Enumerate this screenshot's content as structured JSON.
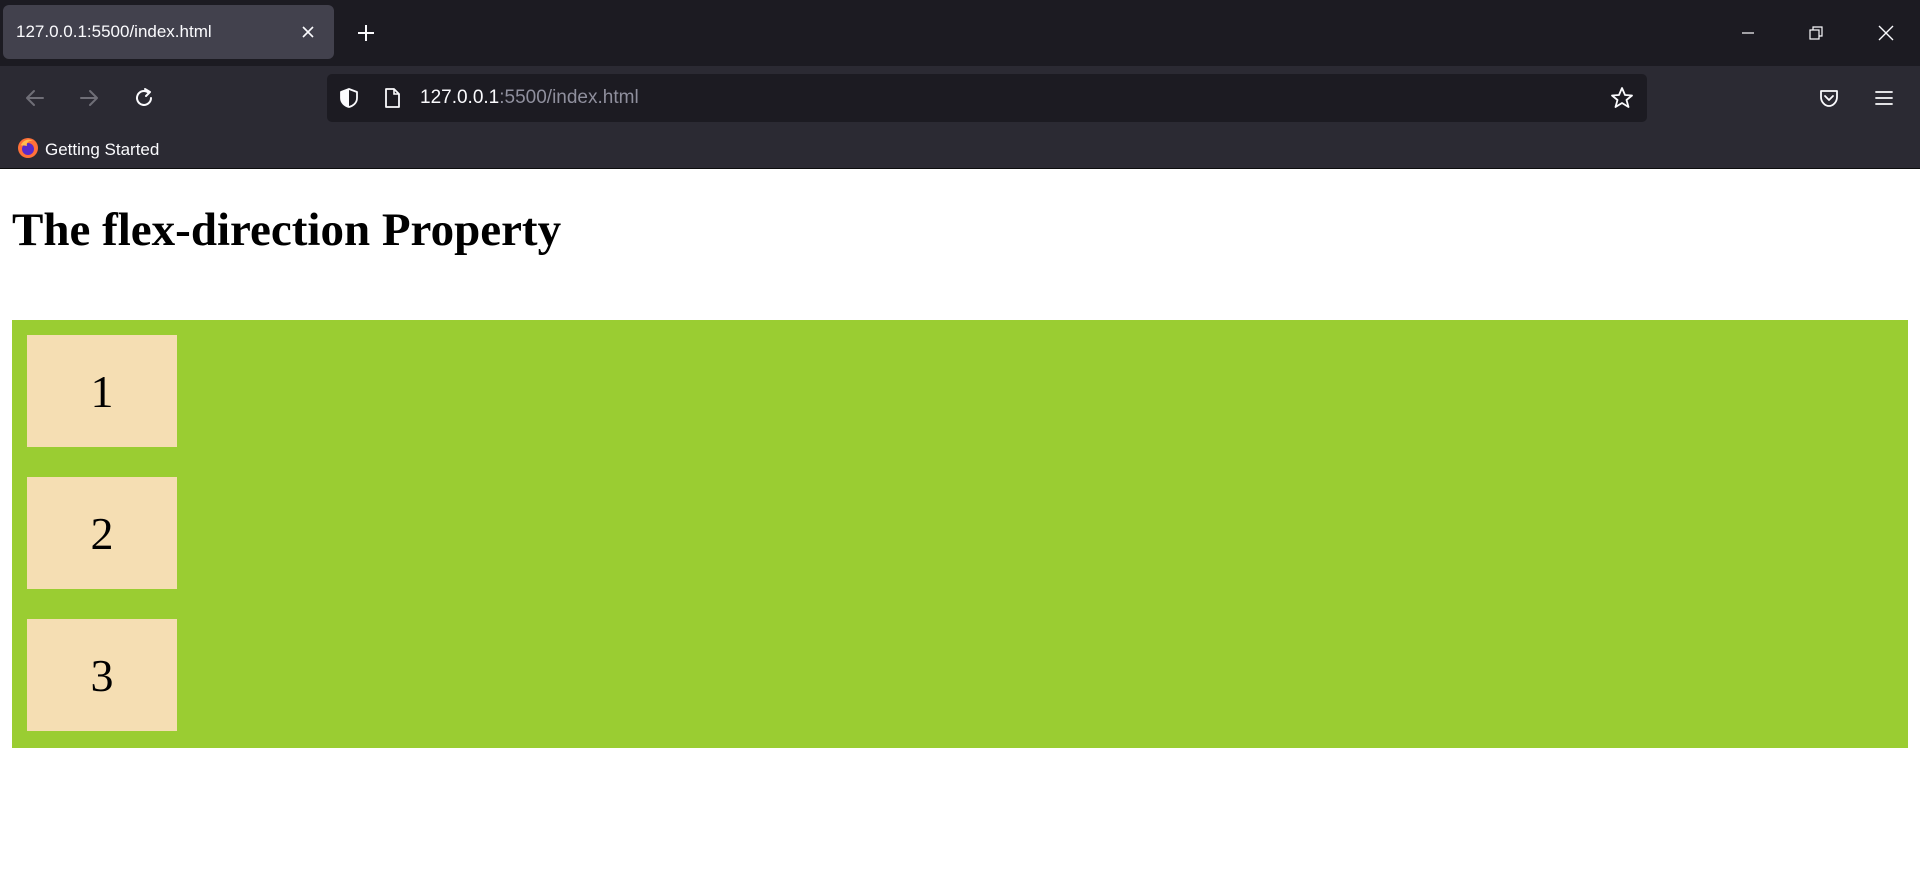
{
  "browser": {
    "tab": {
      "title": "127.0.0.1:5500/index.html"
    },
    "url": {
      "host": "127.0.0.1",
      "rest": ":5500/index.html"
    },
    "bookmarks": [
      {
        "label": "Getting Started"
      }
    ]
  },
  "page": {
    "title": "The flex-direction Property",
    "container_color": "#9acd32",
    "item_color": "#f5deb3",
    "items": [
      "1",
      "2",
      "3"
    ]
  }
}
